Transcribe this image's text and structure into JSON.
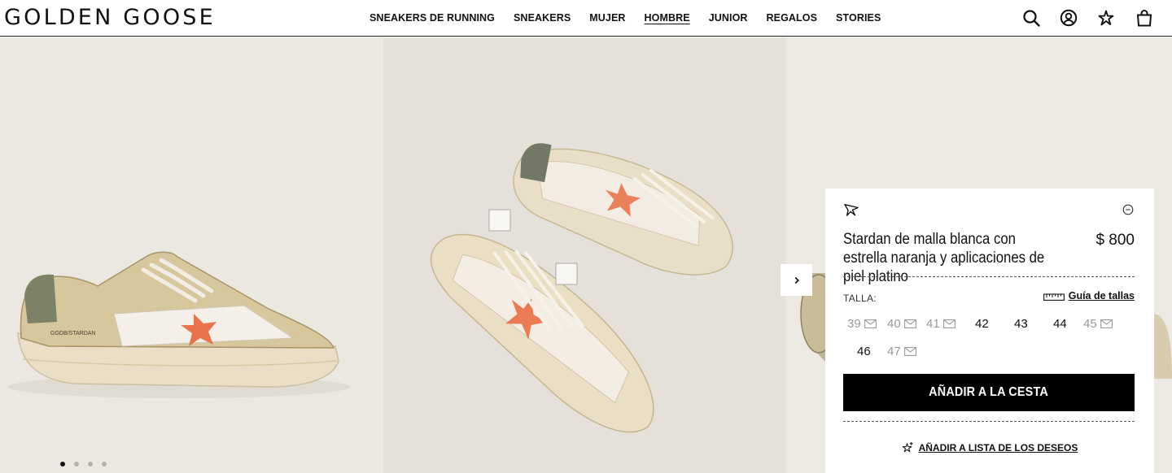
{
  "brand": {
    "name": "GOLDEN GOOSE"
  },
  "nav": {
    "items": [
      {
        "label": "SNEAKERS DE RUNNING",
        "active": false
      },
      {
        "label": "SNEAKERS",
        "active": false
      },
      {
        "label": "MUJER",
        "active": false
      },
      {
        "label": "HOMBRE",
        "active": true
      },
      {
        "label": "JUNIOR",
        "active": false
      },
      {
        "label": "REGALOS",
        "active": false
      },
      {
        "label": "STORIES",
        "active": false
      }
    ]
  },
  "header_icons": [
    "search-icon",
    "account-icon",
    "wishlist-star-icon",
    "bag-icon"
  ],
  "gallery": {
    "dots": {
      "count": 4,
      "active_index": 0
    },
    "stamp_text": "GGDB/STARDAN"
  },
  "product": {
    "name": "Stardan de malla blanca con estrella naranja y aplicaciones de piel platino",
    "price": "$ 800",
    "size_label": "TALLA:",
    "size_guide_label": "Guía de tallas",
    "sizes": [
      {
        "value": "39",
        "available": false
      },
      {
        "value": "40",
        "available": false
      },
      {
        "value": "41",
        "available": false
      },
      {
        "value": "42",
        "available": true
      },
      {
        "value": "43",
        "available": true
      },
      {
        "value": "44",
        "available": true
      },
      {
        "value": "45",
        "available": false
      },
      {
        "value": "46",
        "available": true
      },
      {
        "value": "47",
        "available": false
      }
    ],
    "add_to_cart_label": "AÑADIR A LA CESTA",
    "wishlist_label": "AÑADIR A LISTA DE LOS DESEOS"
  },
  "colors": {
    "accent": "#000000",
    "unavailable": "#9a9a9a",
    "star_orange": "#e8663a"
  }
}
